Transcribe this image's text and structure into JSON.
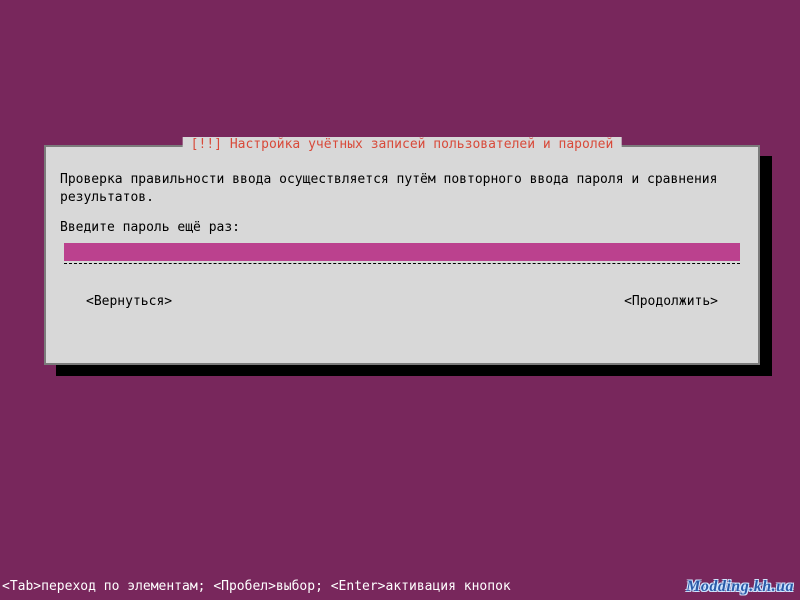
{
  "dialog": {
    "title_prefix": "[!!]",
    "title": "Настройка учётных записей пользователей и паролей",
    "body": "Проверка правильности ввода осуществляется путём повторного ввода пароля и сравнения результатов.",
    "prompt": "Введите пароль ещё раз:",
    "password_value": "",
    "buttons": {
      "back": "<Вернуться>",
      "continue": "<Продолжить>"
    }
  },
  "footer": {
    "hint": "<Tab>переход по элементам; <Пробел>выбор; <Enter>активация кнопок"
  },
  "watermark": "Modding.kh.ua",
  "colors": {
    "background": "#78275c",
    "dialog_bg": "#d8d8d8",
    "dialog_border": "#7b7b7b",
    "title_color": "#d84a3a",
    "input_bg": "#bb418e"
  }
}
